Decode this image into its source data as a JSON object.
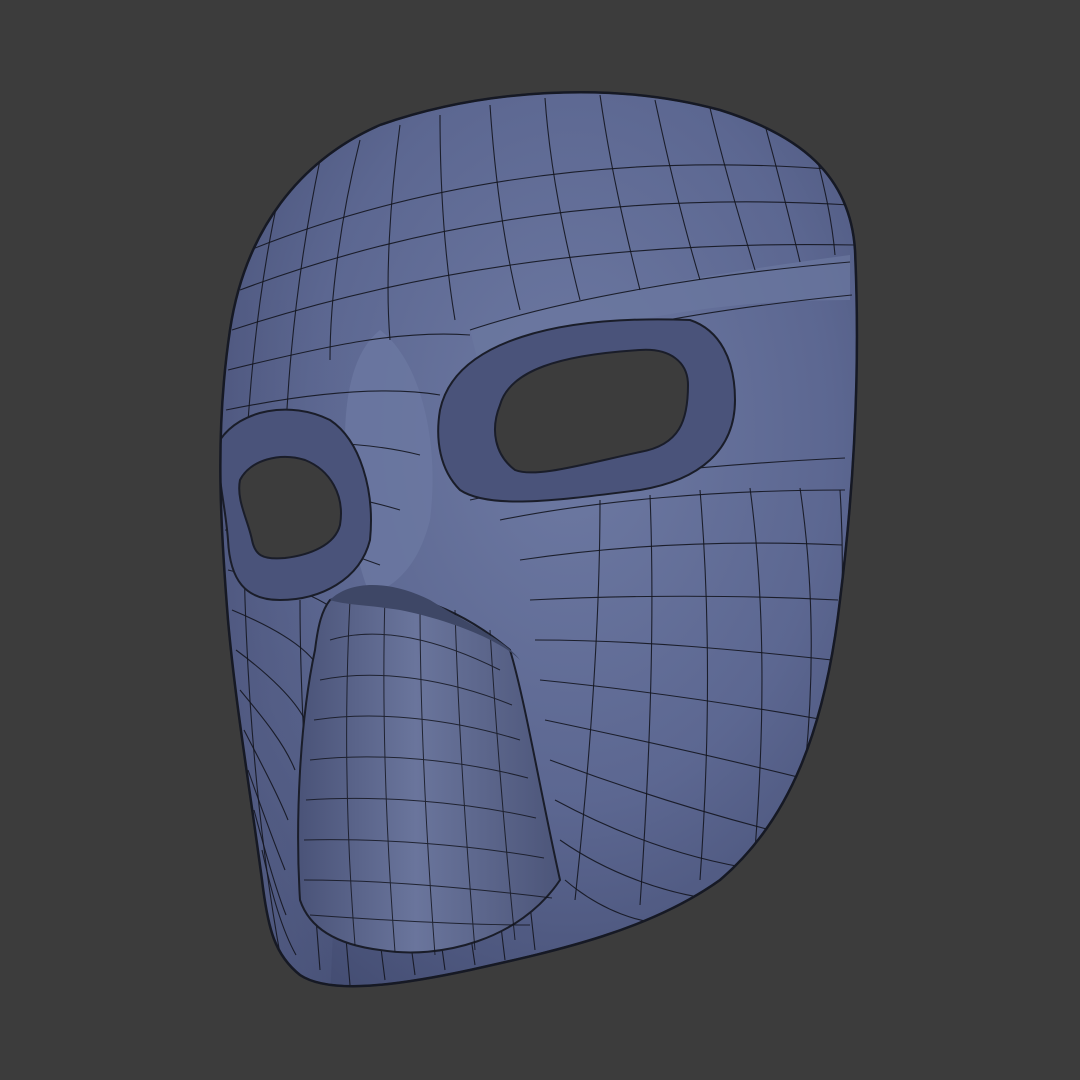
{
  "viewport": {
    "background_color": "#3c3c3c"
  },
  "mask_model": {
    "shading": "matcap",
    "display": "wireframe-overlay",
    "base_color": "#5c6791",
    "highlight_color": "#7a86ad",
    "shadow_color": "#3e4766",
    "edge_color": "#141620"
  }
}
